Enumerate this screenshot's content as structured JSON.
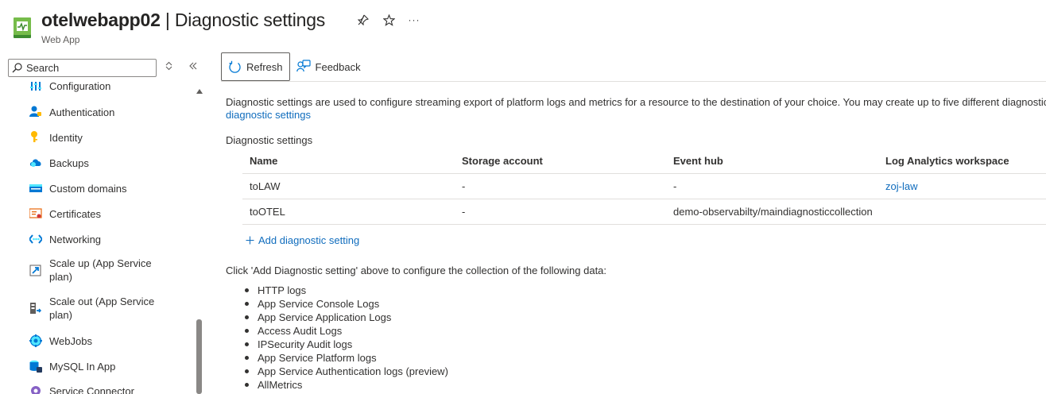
{
  "header": {
    "resource_name": "otelwebapp02",
    "separator": " | ",
    "page_name": "Diagnostic settings",
    "resource_type": "Web App",
    "icons": [
      "pin-icon",
      "star-icon",
      "more-icon"
    ],
    "more_label": "···"
  },
  "sidebar": {
    "search_placeholder": "Search",
    "items": [
      {
        "label": "Configuration",
        "icon": "configuration-icon"
      },
      {
        "label": "Authentication",
        "icon": "authentication-icon"
      },
      {
        "label": "Identity",
        "icon": "identity-icon"
      },
      {
        "label": "Backups",
        "icon": "backups-icon"
      },
      {
        "label": "Custom domains",
        "icon": "custom-domains-icon"
      },
      {
        "label": "Certificates",
        "icon": "certificates-icon"
      },
      {
        "label": "Networking",
        "icon": "networking-icon"
      },
      {
        "label": "Scale up (App Service plan)",
        "icon": "scale-up-icon"
      },
      {
        "label": "Scale out (App Service plan)",
        "icon": "scale-out-icon"
      },
      {
        "label": "WebJobs",
        "icon": "webjobs-icon"
      },
      {
        "label": "MySQL In App",
        "icon": "mysql-icon"
      },
      {
        "label": "Service Connector",
        "icon": "service-connector-icon"
      }
    ]
  },
  "toolbar": {
    "refresh_label": "Refresh",
    "feedback_label": "Feedback"
  },
  "content": {
    "description": "Diagnostic settings are used to configure streaming export of platform logs and metrics for a resource to the destination of your choice. You may create up to five different diagnostic",
    "description_link": "diagnostic settings",
    "section_label": "Diagnostic settings",
    "table": {
      "columns": [
        "Name",
        "Storage account",
        "Event hub",
        "Log Analytics workspace"
      ],
      "rows": [
        [
          "toLAW",
          "-",
          "-",
          "zoj-law"
        ],
        [
          "toOTEL",
          "-",
          "demo-observabilty/maindiagnosticcollection",
          ""
        ]
      ]
    },
    "add_setting_label": "Add diagnostic setting",
    "click_text": "Click 'Add Diagnostic setting' above to configure the collection of the following data:",
    "data_categories": [
      "HTTP logs",
      "App Service Console Logs",
      "App Service Application Logs",
      "Access Audit Logs",
      "IPSecurity Audit logs",
      "App Service Platform logs",
      "App Service Authentication logs (preview)",
      "AllMetrics"
    ]
  },
  "colors": {
    "link": "#0f6cbd",
    "text": "#323130",
    "web_app_icon": "#5ea94b"
  }
}
